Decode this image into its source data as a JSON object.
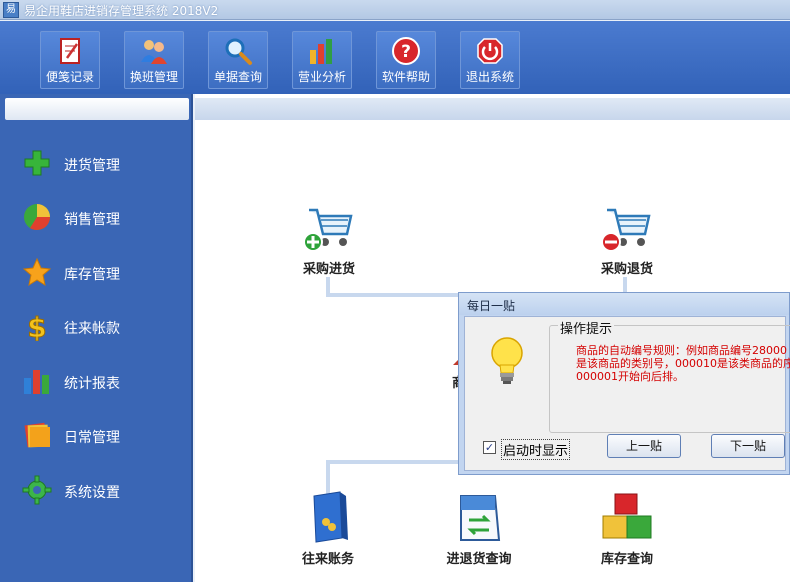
{
  "window": {
    "title": "易企用鞋店进销存管理系统 2018V2"
  },
  "toolbar": {
    "buttons": [
      {
        "label": "便笺记录",
        "icon": "notepad-icon"
      },
      {
        "label": "换班管理",
        "icon": "users-icon"
      },
      {
        "label": "单据查询",
        "icon": "magnifier-icon"
      },
      {
        "label": "营业分析",
        "icon": "bar-chart-icon"
      },
      {
        "label": "软件帮助",
        "icon": "help-icon"
      },
      {
        "label": "退出系统",
        "icon": "power-icon"
      }
    ]
  },
  "sidebar": {
    "items": [
      {
        "label": "进货管理",
        "icon": "plus-icon"
      },
      {
        "label": "销售管理",
        "icon": "pie-chart-icon"
      },
      {
        "label": "库存管理",
        "icon": "star-icon"
      },
      {
        "label": "往来帐款",
        "icon": "dollar-icon"
      },
      {
        "label": "统计报表",
        "icon": "chart-icon"
      },
      {
        "label": "日常管理",
        "icon": "folders-icon"
      },
      {
        "label": "系统设置",
        "icon": "gear-icon"
      }
    ]
  },
  "main": {
    "flow": [
      {
        "label": "采购进货",
        "icon": "cart-add-icon"
      },
      {
        "label": "采购退货",
        "icon": "cart-remove-icon"
      },
      {
        "label": "往来账务",
        "icon": "ledger-book-icon"
      },
      {
        "label": "进退货查询",
        "icon": "exchange-doc-icon"
      },
      {
        "label": "库存查询",
        "icon": "boxes-icon"
      }
    ],
    "partial_label": "商"
  },
  "dialog": {
    "title": "每日一贴",
    "group_title": "操作提示",
    "tip_lines": [
      "商品的自动编号规则：例如商品编号28000",
      "是该商品的类别号，000010是该类商品的序",
      "000001开始向后排。"
    ],
    "checkbox_label": "启动时显示",
    "checkbox_checked": true,
    "prev_button": "上一贴",
    "next_button": "下一贴"
  }
}
